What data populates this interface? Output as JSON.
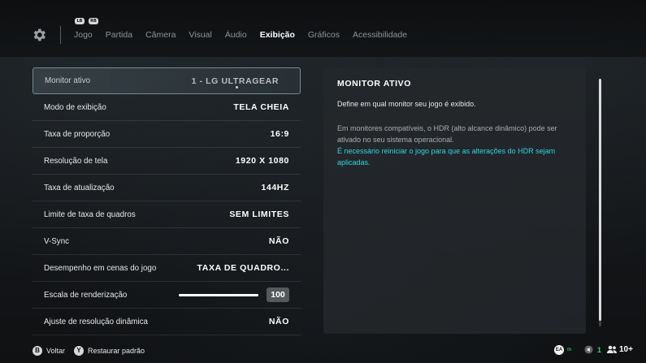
{
  "header": {
    "left_shoulder": "LB",
    "right_shoulder": "RB",
    "tabs": [
      "Jogo",
      "Partida",
      "Câmera",
      "Visual",
      "Áudio",
      "Exibição",
      "Gráficos",
      "Acessibilidade"
    ],
    "active_tab": "Exibição"
  },
  "settings": [
    {
      "label": "Monitor ativo",
      "value": "1 - LG ULTRAGEAR"
    },
    {
      "label": "Modo de exibição",
      "value": "TELA CHEIA"
    },
    {
      "label": "Taxa de proporção",
      "value": "16:9"
    },
    {
      "label": "Resolução de tela",
      "value": "1920 X 1080"
    },
    {
      "label": "Taxa de atualização",
      "value": "144HZ"
    },
    {
      "label": "Limite de taxa de quadros",
      "value": "SEM LIMITES"
    },
    {
      "label": "V-Sync",
      "value": "NÃO"
    },
    {
      "label": "Desempenho em cenas do jogo",
      "value": "TAXA DE QUADRO..."
    },
    {
      "label": "Escala de renderização",
      "value": "100",
      "slider_level_percent": 100
    },
    {
      "label": "Ajuste de resolução dinâmica",
      "value": "NÃO"
    }
  ],
  "detail": {
    "title": "MONITOR ATIVO",
    "description": "Define em qual monitor seu jogo é exibido.",
    "note": "Em monitores compatíveis, o HDR (alto alcance dinâmico) pode ser ativado no seu sistema operacional.",
    "warning": "É necessário reiniciar o jogo para que as alterações do HDR sejam aplicadas."
  },
  "footer": {
    "back_button": "B",
    "back_label": "Voltar",
    "restore_button": "Y",
    "restore_label": "Restaurar padrão",
    "ea_badge": "EA",
    "ea_small": "8h",
    "volume_count": "1",
    "friends_count": "10+"
  },
  "colors": {
    "accent_cyan": "#2fd6e0",
    "online_green": "#3ccf6e"
  }
}
